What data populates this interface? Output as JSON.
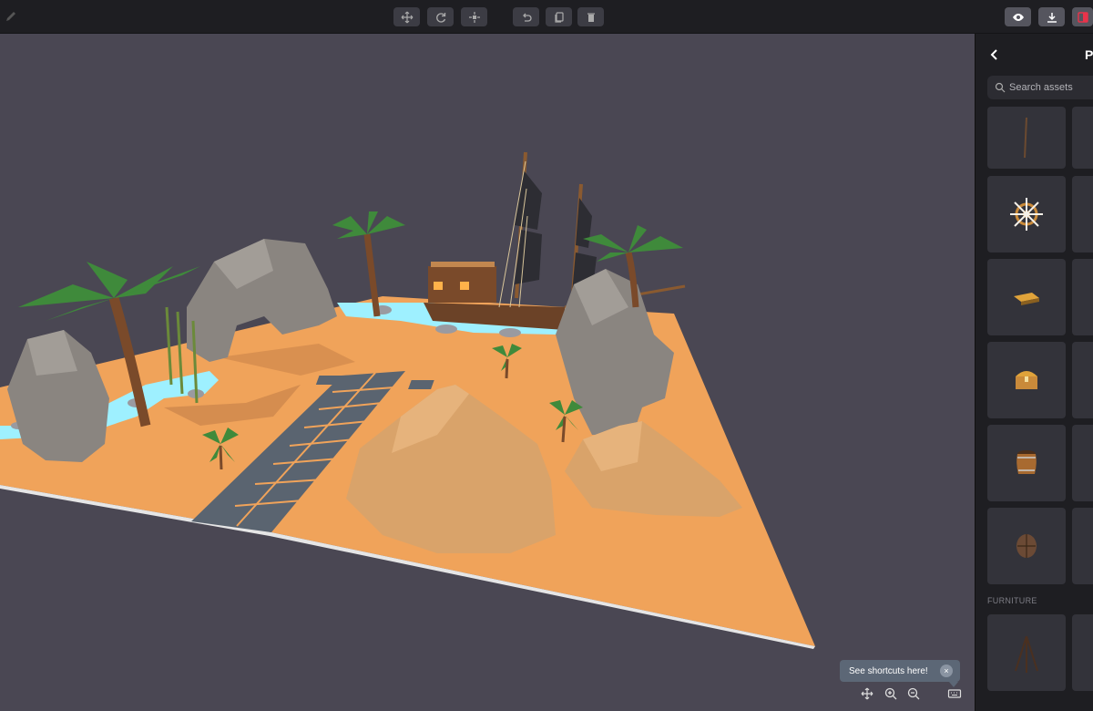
{
  "toolbar": {
    "left": [
      {
        "icon": "pencil-icon"
      }
    ],
    "center_group1": [
      {
        "icon": "move-icon"
      },
      {
        "icon": "rotate-icon"
      },
      {
        "icon": "scale-icon"
      }
    ],
    "center_group2": [
      {
        "icon": "undo-icon"
      },
      {
        "icon": "duplicate-icon"
      },
      {
        "icon": "delete-icon"
      }
    ],
    "right": [
      {
        "icon": "eye-icon"
      },
      {
        "icon": "download-icon"
      },
      {
        "icon": "panel-toggle-icon"
      }
    ]
  },
  "panel": {
    "title": "P",
    "search_placeholder": "Search assets",
    "section_label": "FURNITURE",
    "assets": [
      {
        "icon": "pole-icon"
      },
      {
        "icon": "ship-wheel-icon"
      },
      {
        "icon": "gold-bars-icon"
      },
      {
        "icon": "treasure-chest-icon"
      },
      {
        "icon": "barrel-icon"
      },
      {
        "icon": "wooden-shield-icon"
      },
      {
        "icon": "tripod-icon"
      }
    ]
  },
  "tooltip": {
    "text": "See shortcuts here!",
    "close": "×"
  },
  "colors": {
    "sand": "#f0a35a",
    "water": "#9ef0ff",
    "rock": "#8a8580",
    "dune": "#d9a36a",
    "palm": "#3f8a3b",
    "accent": "#e8334a"
  }
}
